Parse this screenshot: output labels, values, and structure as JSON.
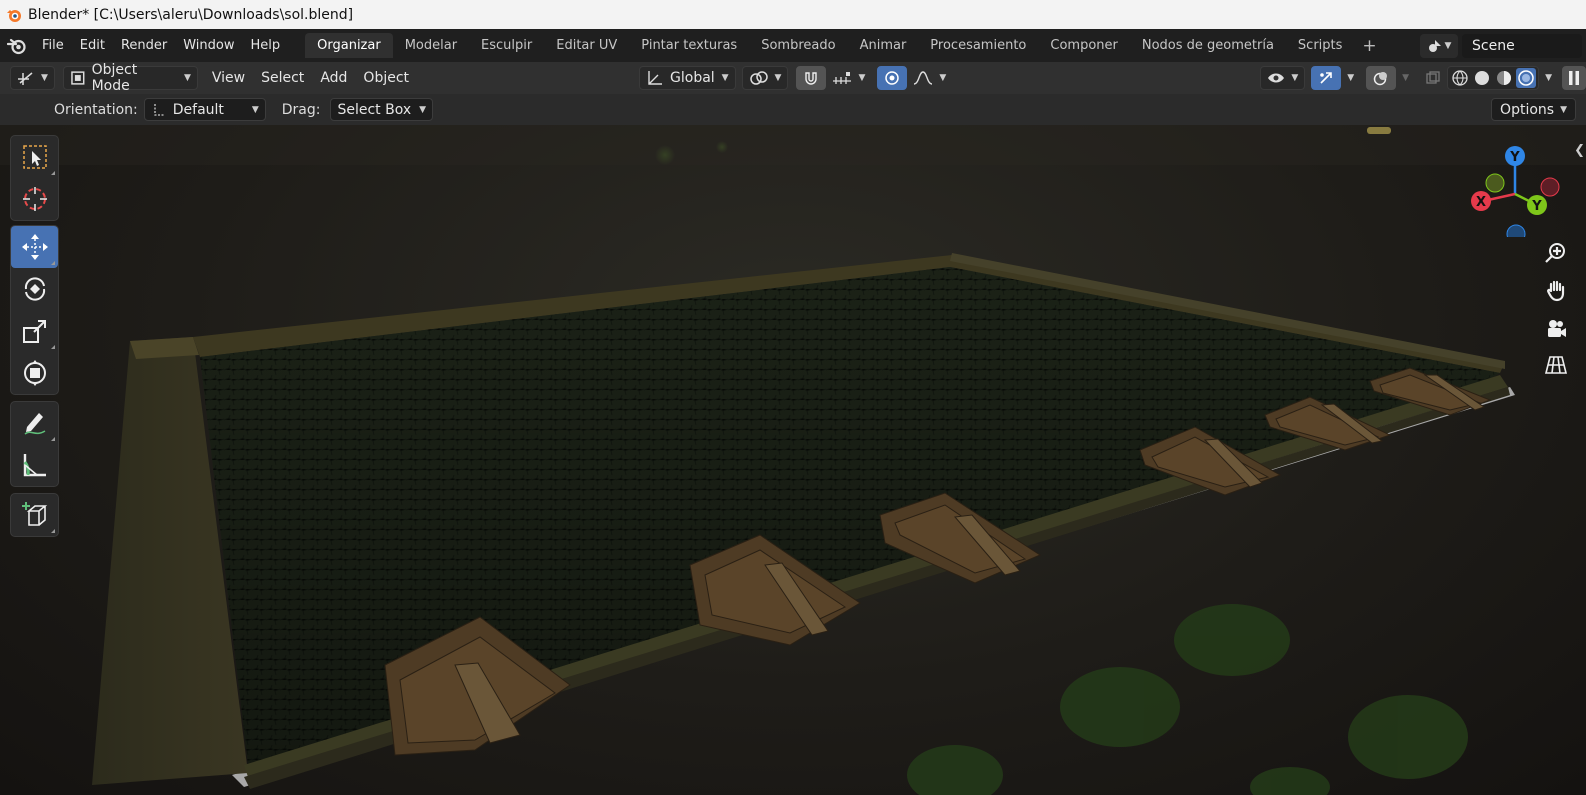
{
  "window": {
    "title": "Blender* [C:\\Users\\aleru\\Downloads\\sol.blend]"
  },
  "menu": {
    "items": [
      "File",
      "Edit",
      "Render",
      "Window",
      "Help"
    ]
  },
  "workspaces": {
    "tabs": [
      "Organizar",
      "Modelar",
      "Esculpir",
      "Editar UV",
      "Pintar texturas",
      "Sombreado",
      "Animar",
      "Procesamiento",
      "Componer",
      "Nodos de geometría",
      "Scripts"
    ],
    "active": "Organizar",
    "add_label": "+"
  },
  "scene": {
    "name": "Scene"
  },
  "viewport_header": {
    "mode": "Object Mode",
    "menus": [
      "View",
      "Select",
      "Add",
      "Object"
    ],
    "transform_orientation": "Global"
  },
  "tool_settings": {
    "orientation_label": "Orientation:",
    "orientation_value": "Default",
    "drag_label": "Drag:",
    "drag_value": "Select Box",
    "options_label": "Options"
  },
  "gizmo": {
    "x_label": "X",
    "y_label": "Y",
    "z_label": "Y",
    "colors": {
      "x": "#e53a4b",
      "y": "#7ec61a",
      "z": "#2f86e6"
    }
  },
  "tools": [
    "select-box",
    "cursor",
    "move",
    "rotate",
    "scale",
    "transform",
    "annotate",
    "measure",
    "add-cube"
  ],
  "active_tool": "move",
  "colors": {
    "accent": "#4772b3",
    "header": "#303030",
    "topbar": "#1f1f1f"
  }
}
